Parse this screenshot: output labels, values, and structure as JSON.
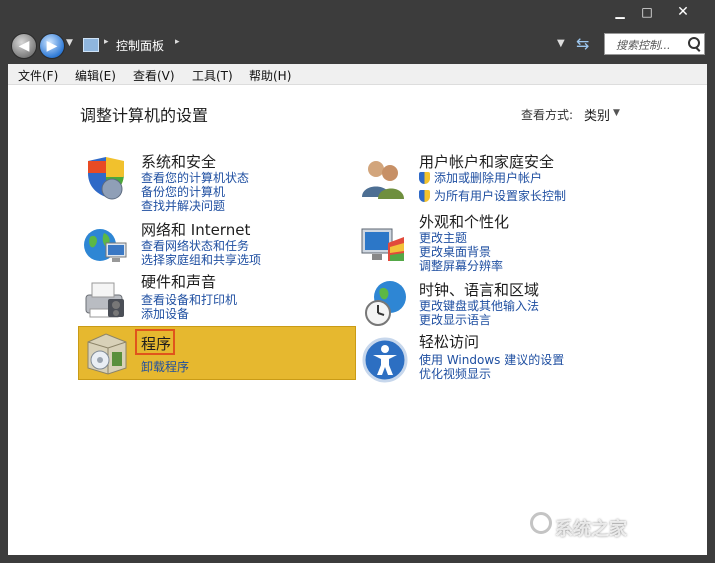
{
  "window": {
    "minimize": "▁",
    "maximize": "□",
    "close": "✕"
  },
  "address": {
    "breadcrumb": "控制面板",
    "search_placeholder": "搜索控制..."
  },
  "menu": [
    "文件(F)",
    "编辑(E)",
    "查看(V)",
    "工具(T)",
    "帮助(H)"
  ],
  "header": {
    "title": "调整计算机的设置",
    "view_by_label": "查看方式:",
    "view_by_value": "类别"
  },
  "categories": [
    {
      "title": "系统和安全",
      "links": [
        "查看您的计算机状态",
        "备份您的计算机",
        "查找并解决问题"
      ],
      "icon": "shield-icon"
    },
    {
      "title": "网络和 Internet",
      "links": [
        "查看网络状态和任务",
        "选择家庭组和共享选项"
      ],
      "icon": "network-globe-icon"
    },
    {
      "title": "硬件和声音",
      "links": [
        "查看设备和打印机",
        "添加设备"
      ],
      "icon": "printer-icon"
    },
    {
      "title": "程序",
      "links": [
        "卸载程序"
      ],
      "icon": "programs-box-icon",
      "selected": true
    },
    {
      "title": "用户帐户和家庭安全",
      "links": [
        "添加或删除用户帐户",
        "为所有用户设置家长控制"
      ],
      "icon": "users-icon"
    },
    {
      "title": "外观和个性化",
      "links": [
        "更改主题",
        "更改桌面背景",
        "调整屏幕分辨率"
      ],
      "icon": "monitor-palette-icon"
    },
    {
      "title": "时钟、语言和区域",
      "links": [
        "更改键盘或其他输入法",
        "更改显示语言"
      ],
      "icon": "clock-globe-icon"
    },
    {
      "title": "轻松访问",
      "links": [
        "使用 Windows 建议的设置",
        "优化视频显示"
      ],
      "icon": "ease-of-access-icon"
    }
  ],
  "watermark": "系统之家",
  "colors": {
    "link": "#1f4fa1",
    "selected": "#e6b82f",
    "highlight_border": "#e0541c"
  }
}
